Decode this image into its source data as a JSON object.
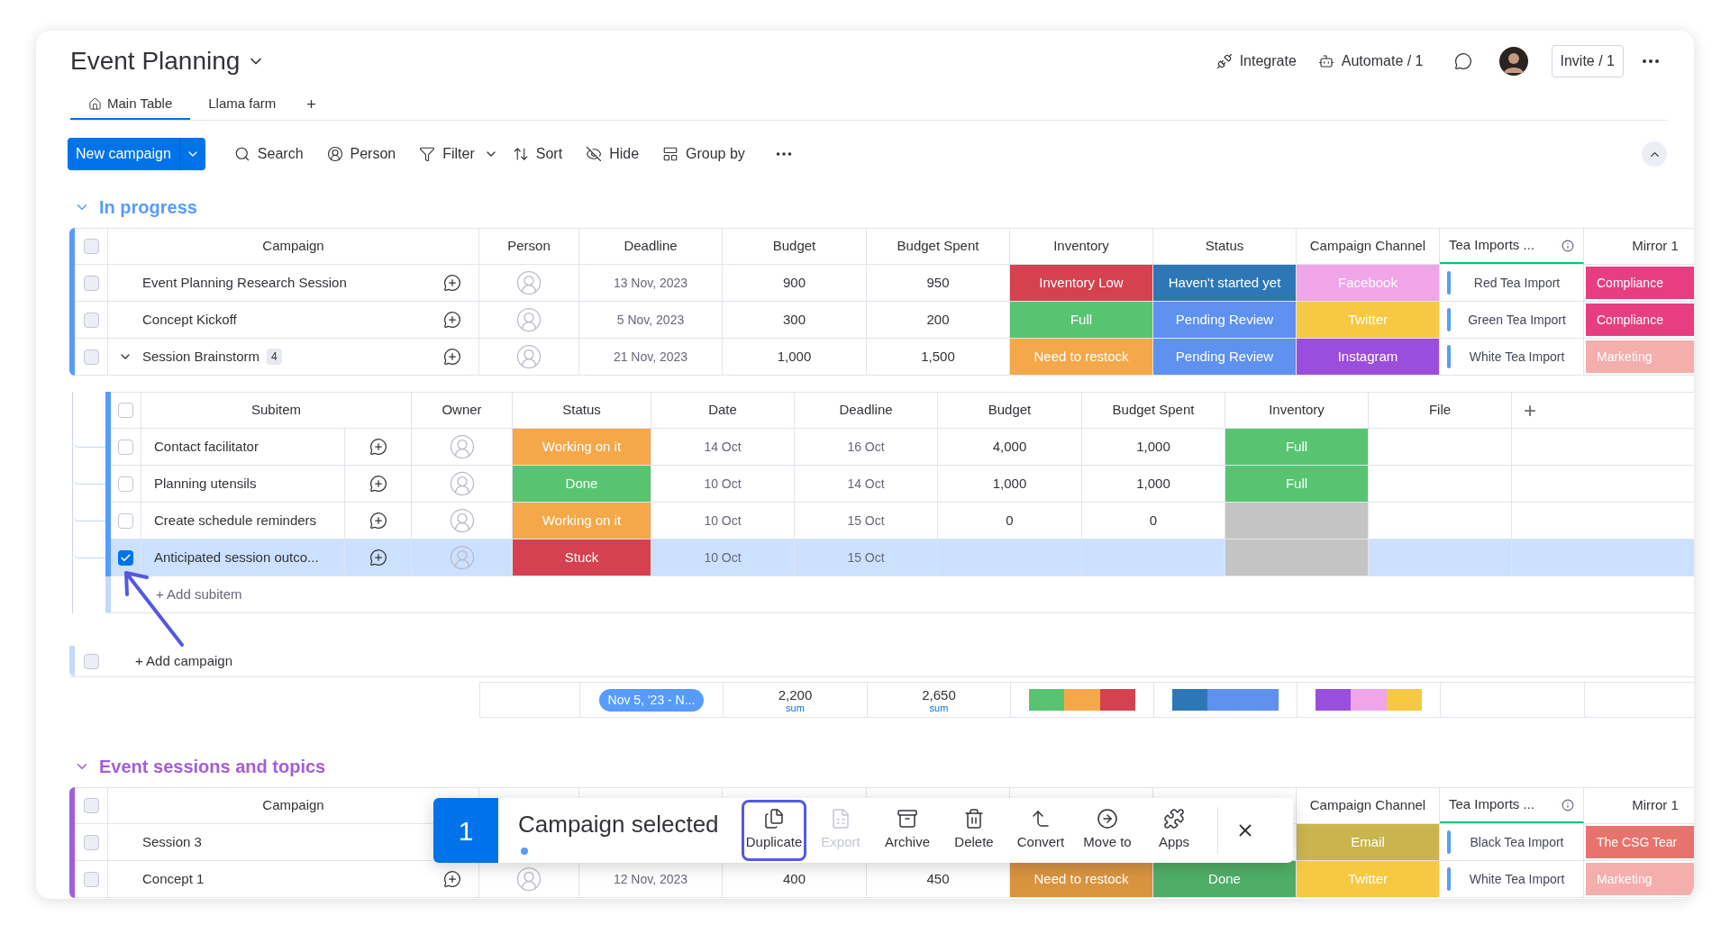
{
  "board": {
    "title": "Event Planning"
  },
  "header_actions": [
    {
      "kind": "integrate",
      "label": "Integrate"
    },
    {
      "kind": "automate",
      "label": "Automate / 1"
    }
  ],
  "invite": "Invite / 1",
  "tabs": [
    {
      "kind": "home",
      "label": "Main Table",
      "selected": true
    },
    {
      "kind": "plain",
      "label": "Llama farm",
      "selected": false
    }
  ],
  "add_tab": "+",
  "toolbar": {
    "new_button": "New campaign",
    "items": [
      {
        "kind": "search",
        "label": "Search"
      },
      {
        "kind": "person",
        "label": "Person"
      },
      {
        "kind": "filter",
        "label": "Filter"
      },
      {
        "kind": "sort",
        "label": "Sort"
      },
      {
        "kind": "hide",
        "label": "Hide"
      },
      {
        "kind": "group",
        "label": "Group by"
      }
    ]
  },
  "groups": [
    {
      "title": "In progress",
      "color": "#579bfc",
      "all_checked": false,
      "columns": {
        "campaign": "Campaign",
        "person": "Person",
        "deadline": "Deadline",
        "budget": "Budget",
        "spent": "Budget Spent",
        "inventory": "Inventory",
        "status": "Status",
        "channel": "Campaign Channel",
        "tea": "Tea Imports ...",
        "mirror": "Mirror 1"
      },
      "rows": [
        {
          "kind": "item",
          "name": "Event Planning Research Session",
          "checked": false,
          "deadline": "13 Nov, 2023",
          "budget": "900",
          "spent": "950",
          "inventory": {
            "label": "Inventory Low",
            "color": "#d5414f"
          },
          "status": {
            "label": "Haven't started yet",
            "color": "#2e77b7"
          },
          "channel": {
            "label": "Facebook",
            "color": "#efa5e8"
          },
          "tea": "Red Tea Import",
          "mirror": {
            "label": "Compliance",
            "color": "#e63e80"
          }
        },
        {
          "kind": "item",
          "name": "Concept Kickoff",
          "checked": false,
          "deadline": "5 Nov, 2023",
          "budget": "300",
          "spent": "200",
          "inventory": {
            "label": "Full",
            "color": "#58c472"
          },
          "status": {
            "label": "Pending Review",
            "color": "#5e91f0"
          },
          "channel": {
            "label": "Twitter",
            "color": "#f7c843"
          },
          "tea": "Green Tea Import",
          "mirror": {
            "label": "Compliance",
            "color": "#e63e80"
          }
        },
        {
          "kind": "parent",
          "name": "Session Brainstorm",
          "subitem_count": "4",
          "expanded": true,
          "checked": false,
          "deadline": "21 Nov, 2023",
          "budget": "1,000",
          "spent": "1,500",
          "inventory": {
            "label": "Need to restock",
            "color": "#f5a84a"
          },
          "status": {
            "label": "Pending Review",
            "color": "#5e91f0"
          },
          "channel": {
            "label": "Instagram",
            "color": "#9a4fdc"
          },
          "tea": "White Tea Import",
          "mirror": {
            "label": "Marketing",
            "color": "#f4aeab"
          }
        }
      ],
      "subitems": {
        "all_checked": false,
        "columns": {
          "subitem": "Subitem",
          "owner": "Owner",
          "status": "Status",
          "date": "Date",
          "deadline": "Deadline",
          "budget": "Budget",
          "spent": "Budget Spent",
          "inventory": "Inventory",
          "file": "File"
        },
        "add_column": "+",
        "rows": [
          {
            "name": "Contact facilitator",
            "checked": false,
            "status": {
              "label": "Working on it",
              "color": "#f5a84a"
            },
            "date": "14 Oct",
            "deadline": "16 Oct",
            "budget": "4,000",
            "spent": "1,000",
            "inventory": {
              "label": "Full",
              "color": "#58c472"
            }
          },
          {
            "name": "Planning utensils",
            "checked": false,
            "status": {
              "label": "Done",
              "color": "#58c472"
            },
            "date": "10 Oct",
            "deadline": "14 Oct",
            "budget": "1,000",
            "spent": "1,000",
            "inventory": {
              "label": "Full",
              "color": "#58c472"
            }
          },
          {
            "name": "Create schedule reminders",
            "checked": false,
            "status": {
              "label": "Working on it",
              "color": "#f5a84a"
            },
            "date": "10 Oct",
            "deadline": "15 Oct",
            "budget": "0",
            "spent": "0",
            "inventory": {
              "color": "#c4c4c4"
            }
          },
          {
            "name": "Anticipated session outco...",
            "checked": true,
            "status": {
              "label": "Stuck",
              "color": "#d5414f"
            },
            "date": "10 Oct",
            "deadline": "15 Oct",
            "inventory": {
              "color": "#c4c4c4"
            }
          }
        ],
        "add_row": "+ Add subitem"
      },
      "add_row": {
        "label": "+ Add campaign",
        "checked": false
      },
      "summary": {
        "deadline": "Nov 5, '23 - N...",
        "budget": "2,200",
        "budget_unit": "sum",
        "spent": "2,650",
        "spent_unit": "sum",
        "inventory": [
          {
            "color": "#58c472"
          },
          {
            "color": "#f5a84a"
          },
          {
            "color": "#d5414f"
          }
        ],
        "status": [
          {
            "color": "#2e77b7"
          },
          {
            "color": "#5e91f0"
          },
          {
            "color": "#5e91f0"
          }
        ],
        "channel": [
          {
            "color": "#9a4fdc"
          },
          {
            "color": "#efa5e8"
          },
          {
            "color": "#f7c843"
          }
        ]
      }
    },
    {
      "title": "Event sessions and topics",
      "color": "#a25ddc",
      "all_checked": false,
      "columns": {
        "campaign": "Campaign",
        "channel": "Campaign Channel",
        "tea": "Tea Imports ...",
        "mirror": "Mirror 1"
      },
      "rows": [
        {
          "kind": "item",
          "name": "Session 3",
          "checked": false,
          "channel": {
            "label": "Email",
            "color": "#c9b44e"
          },
          "tea": "Black Tea Import",
          "mirror": {
            "label": "The CSG Tear",
            "color": "#e8736c"
          }
        },
        {
          "kind": "item",
          "name": "Concept 1",
          "checked": false,
          "deadline": "12 Nov, 2023",
          "budget": "400",
          "spent": "450",
          "inventory": {
            "label": "Need to restock",
            "color": "#d99440"
          },
          "status": {
            "label": "Done",
            "color": "#4fad66"
          },
          "channel": {
            "label": "Twitter",
            "color": "#f7c843"
          },
          "tea": "White Tea Import",
          "mirror": {
            "label": "Marketing",
            "color": "#f4aeab"
          }
        }
      ]
    }
  ],
  "action_bar": {
    "count": "1",
    "title": "Campaign selected",
    "actions": [
      {
        "kind": "duplicate",
        "label": "Duplicate",
        "selected": true,
        "disabled": false
      },
      {
        "kind": "export",
        "label": "Export",
        "selected": false,
        "disabled": true
      },
      {
        "kind": "archive",
        "label": "Archive",
        "selected": false,
        "disabled": false
      },
      {
        "kind": "delete",
        "label": "Delete",
        "selected": false,
        "disabled": false
      },
      {
        "kind": "convert",
        "label": "Convert",
        "selected": false,
        "disabled": false
      },
      {
        "kind": "move",
        "label": "Move to",
        "selected": false,
        "disabled": false
      },
      {
        "kind": "apps",
        "label": "Apps",
        "selected": false,
        "disabled": false
      }
    ]
  }
}
